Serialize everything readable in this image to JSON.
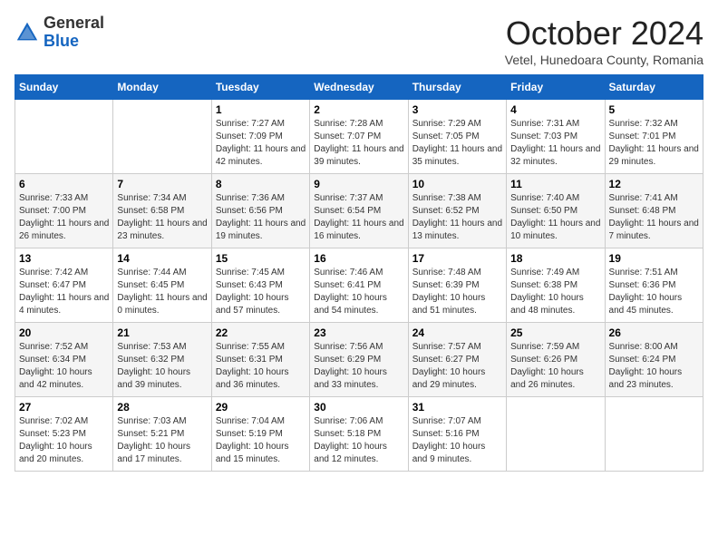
{
  "logo": {
    "general": "General",
    "blue": "Blue"
  },
  "header": {
    "month": "October 2024",
    "location": "Vetel, Hunedoara County, Romania"
  },
  "weekdays": [
    "Sunday",
    "Monday",
    "Tuesday",
    "Wednesday",
    "Thursday",
    "Friday",
    "Saturday"
  ],
  "weeks": [
    [
      {
        "day": "",
        "sunrise": "",
        "sunset": "",
        "daylight": ""
      },
      {
        "day": "",
        "sunrise": "",
        "sunset": "",
        "daylight": ""
      },
      {
        "day": "1",
        "sunrise": "Sunrise: 7:27 AM",
        "sunset": "Sunset: 7:09 PM",
        "daylight": "Daylight: 11 hours and 42 minutes."
      },
      {
        "day": "2",
        "sunrise": "Sunrise: 7:28 AM",
        "sunset": "Sunset: 7:07 PM",
        "daylight": "Daylight: 11 hours and 39 minutes."
      },
      {
        "day": "3",
        "sunrise": "Sunrise: 7:29 AM",
        "sunset": "Sunset: 7:05 PM",
        "daylight": "Daylight: 11 hours and 35 minutes."
      },
      {
        "day": "4",
        "sunrise": "Sunrise: 7:31 AM",
        "sunset": "Sunset: 7:03 PM",
        "daylight": "Daylight: 11 hours and 32 minutes."
      },
      {
        "day": "5",
        "sunrise": "Sunrise: 7:32 AM",
        "sunset": "Sunset: 7:01 PM",
        "daylight": "Daylight: 11 hours and 29 minutes."
      }
    ],
    [
      {
        "day": "6",
        "sunrise": "Sunrise: 7:33 AM",
        "sunset": "Sunset: 7:00 PM",
        "daylight": "Daylight: 11 hours and 26 minutes."
      },
      {
        "day": "7",
        "sunrise": "Sunrise: 7:34 AM",
        "sunset": "Sunset: 6:58 PM",
        "daylight": "Daylight: 11 hours and 23 minutes."
      },
      {
        "day": "8",
        "sunrise": "Sunrise: 7:36 AM",
        "sunset": "Sunset: 6:56 PM",
        "daylight": "Daylight: 11 hours and 19 minutes."
      },
      {
        "day": "9",
        "sunrise": "Sunrise: 7:37 AM",
        "sunset": "Sunset: 6:54 PM",
        "daylight": "Daylight: 11 hours and 16 minutes."
      },
      {
        "day": "10",
        "sunrise": "Sunrise: 7:38 AM",
        "sunset": "Sunset: 6:52 PM",
        "daylight": "Daylight: 11 hours and 13 minutes."
      },
      {
        "day": "11",
        "sunrise": "Sunrise: 7:40 AM",
        "sunset": "Sunset: 6:50 PM",
        "daylight": "Daylight: 11 hours and 10 minutes."
      },
      {
        "day": "12",
        "sunrise": "Sunrise: 7:41 AM",
        "sunset": "Sunset: 6:48 PM",
        "daylight": "Daylight: 11 hours and 7 minutes."
      }
    ],
    [
      {
        "day": "13",
        "sunrise": "Sunrise: 7:42 AM",
        "sunset": "Sunset: 6:47 PM",
        "daylight": "Daylight: 11 hours and 4 minutes."
      },
      {
        "day": "14",
        "sunrise": "Sunrise: 7:44 AM",
        "sunset": "Sunset: 6:45 PM",
        "daylight": "Daylight: 11 hours and 0 minutes."
      },
      {
        "day": "15",
        "sunrise": "Sunrise: 7:45 AM",
        "sunset": "Sunset: 6:43 PM",
        "daylight": "Daylight: 10 hours and 57 minutes."
      },
      {
        "day": "16",
        "sunrise": "Sunrise: 7:46 AM",
        "sunset": "Sunset: 6:41 PM",
        "daylight": "Daylight: 10 hours and 54 minutes."
      },
      {
        "day": "17",
        "sunrise": "Sunrise: 7:48 AM",
        "sunset": "Sunset: 6:39 PM",
        "daylight": "Daylight: 10 hours and 51 minutes."
      },
      {
        "day": "18",
        "sunrise": "Sunrise: 7:49 AM",
        "sunset": "Sunset: 6:38 PM",
        "daylight": "Daylight: 10 hours and 48 minutes."
      },
      {
        "day": "19",
        "sunrise": "Sunrise: 7:51 AM",
        "sunset": "Sunset: 6:36 PM",
        "daylight": "Daylight: 10 hours and 45 minutes."
      }
    ],
    [
      {
        "day": "20",
        "sunrise": "Sunrise: 7:52 AM",
        "sunset": "Sunset: 6:34 PM",
        "daylight": "Daylight: 10 hours and 42 minutes."
      },
      {
        "day": "21",
        "sunrise": "Sunrise: 7:53 AM",
        "sunset": "Sunset: 6:32 PM",
        "daylight": "Daylight: 10 hours and 39 minutes."
      },
      {
        "day": "22",
        "sunrise": "Sunrise: 7:55 AM",
        "sunset": "Sunset: 6:31 PM",
        "daylight": "Daylight: 10 hours and 36 minutes."
      },
      {
        "day": "23",
        "sunrise": "Sunrise: 7:56 AM",
        "sunset": "Sunset: 6:29 PM",
        "daylight": "Daylight: 10 hours and 33 minutes."
      },
      {
        "day": "24",
        "sunrise": "Sunrise: 7:57 AM",
        "sunset": "Sunset: 6:27 PM",
        "daylight": "Daylight: 10 hours and 29 minutes."
      },
      {
        "day": "25",
        "sunrise": "Sunrise: 7:59 AM",
        "sunset": "Sunset: 6:26 PM",
        "daylight": "Daylight: 10 hours and 26 minutes."
      },
      {
        "day": "26",
        "sunrise": "Sunrise: 8:00 AM",
        "sunset": "Sunset: 6:24 PM",
        "daylight": "Daylight: 10 hours and 23 minutes."
      }
    ],
    [
      {
        "day": "27",
        "sunrise": "Sunrise: 7:02 AM",
        "sunset": "Sunset: 5:23 PM",
        "daylight": "Daylight: 10 hours and 20 minutes."
      },
      {
        "day": "28",
        "sunrise": "Sunrise: 7:03 AM",
        "sunset": "Sunset: 5:21 PM",
        "daylight": "Daylight: 10 hours and 17 minutes."
      },
      {
        "day": "29",
        "sunrise": "Sunrise: 7:04 AM",
        "sunset": "Sunset: 5:19 PM",
        "daylight": "Daylight: 10 hours and 15 minutes."
      },
      {
        "day": "30",
        "sunrise": "Sunrise: 7:06 AM",
        "sunset": "Sunset: 5:18 PM",
        "daylight": "Daylight: 10 hours and 12 minutes."
      },
      {
        "day": "31",
        "sunrise": "Sunrise: 7:07 AM",
        "sunset": "Sunset: 5:16 PM",
        "daylight": "Daylight: 10 hours and 9 minutes."
      },
      {
        "day": "",
        "sunrise": "",
        "sunset": "",
        "daylight": ""
      },
      {
        "day": "",
        "sunrise": "",
        "sunset": "",
        "daylight": ""
      }
    ]
  ]
}
